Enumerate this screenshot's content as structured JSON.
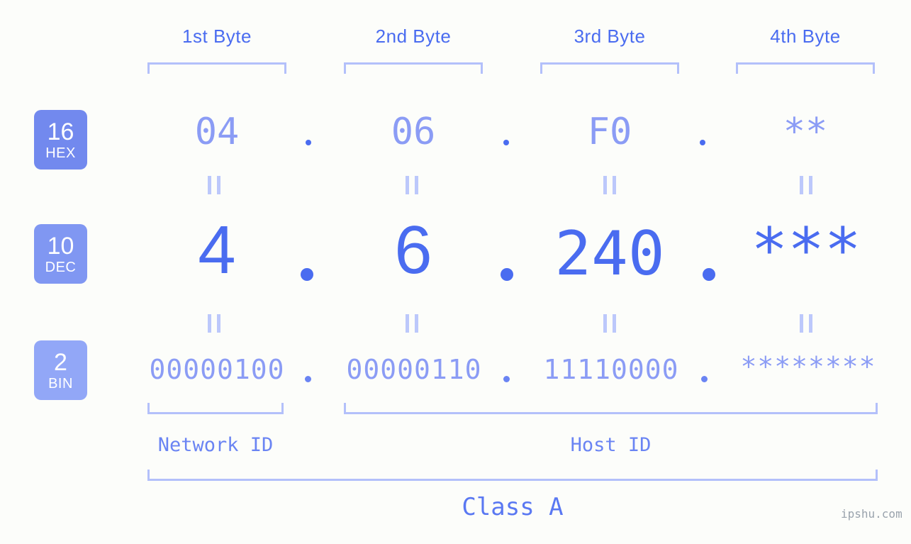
{
  "meta": {
    "background_color": "#fcfdfa",
    "accent_color": "#4a6cf0",
    "accent_light_color": "#8b9cf5",
    "bracket_color": "#b3c0fa",
    "watermark": "ipshu.com"
  },
  "byte_headers": [
    {
      "label": "1st Byte"
    },
    {
      "label": "2nd Byte"
    },
    {
      "label": "3rd Byte"
    },
    {
      "label": "4th Byte"
    }
  ],
  "rows": [
    {
      "badge_number": "16",
      "badge_name": "HEX",
      "badge_color": "#7289ee",
      "values": [
        "04",
        "06",
        "F0",
        "**"
      ],
      "separator": "."
    },
    {
      "badge_number": "10",
      "badge_name": "DEC",
      "badge_color": "#8097f2",
      "values": [
        "4",
        "6",
        "240",
        "***"
      ],
      "separator": "."
    },
    {
      "badge_number": "2",
      "badge_name": "BIN",
      "badge_color": "#92a7f7",
      "values": [
        "00000100",
        "00000110",
        "11110000",
        "********"
      ],
      "separator": "."
    }
  ],
  "separators": {
    "equals_glyph": "="
  },
  "id_spans": [
    {
      "label": "Network ID"
    },
    {
      "label": "Host ID"
    }
  ],
  "class_span": {
    "label": "Class A"
  },
  "address": {
    "hex": "04.06.F0.**",
    "dec": "4.6.240.***",
    "bin": "00000100.00000110.11110000.********",
    "ip_class": "Class A",
    "network_id_bytes": 1,
    "host_id_bytes": 3
  }
}
